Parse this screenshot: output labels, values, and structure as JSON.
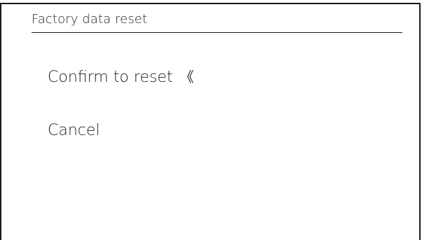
{
  "header": {
    "title": "Factory data reset"
  },
  "menu": {
    "items": [
      {
        "label": "Confirm to reset",
        "selected": true
      },
      {
        "label": "Cancel",
        "selected": false
      }
    ],
    "selection_marker": "《"
  },
  "colors": {
    "background": "#ffffff",
    "text": "#222222",
    "frame": "#1a1a1a"
  }
}
